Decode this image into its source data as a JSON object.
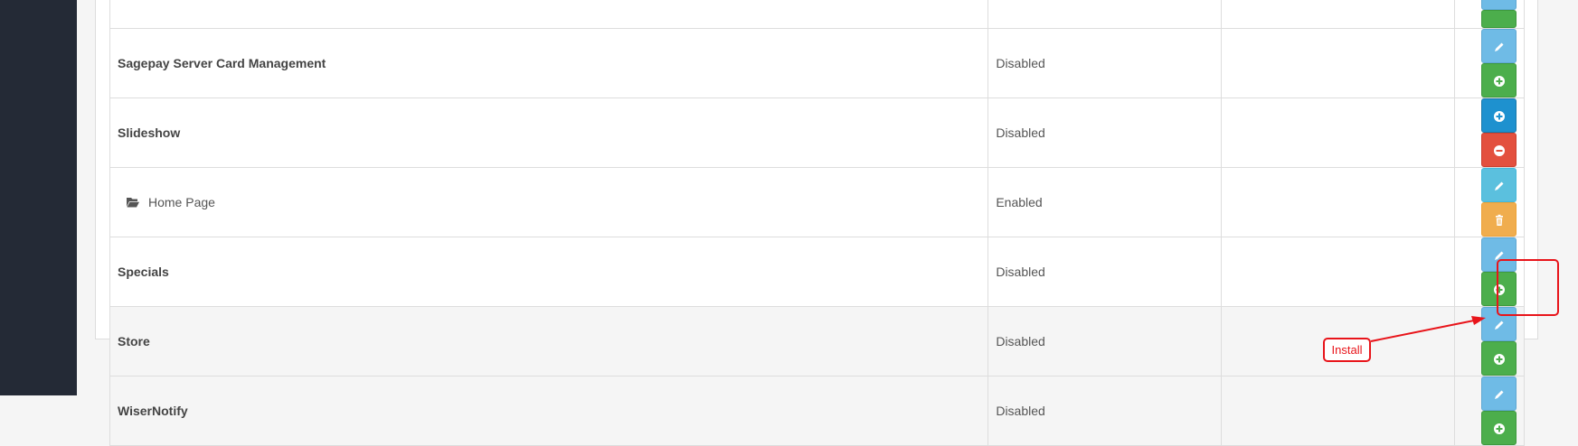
{
  "rows": [
    {
      "name": "Sagepay Server Card Management",
      "status": "Disabled"
    },
    {
      "name": "Slideshow",
      "status": "Disabled"
    },
    {
      "name": "Home Page",
      "status": "Enabled"
    },
    {
      "name": "Specials",
      "status": "Disabled"
    },
    {
      "name": "Store",
      "status": "Disabled"
    },
    {
      "name": "WiserNotify",
      "status": "Disabled"
    }
  ],
  "annotation": {
    "label": "Install",
    "color": "#e8141a"
  },
  "icons": {
    "edit": "pencil-icon",
    "install": "plus-circle-icon",
    "uninstall": "minus-circle-icon",
    "delete": "trash-icon",
    "folder": "folder-open-icon"
  }
}
